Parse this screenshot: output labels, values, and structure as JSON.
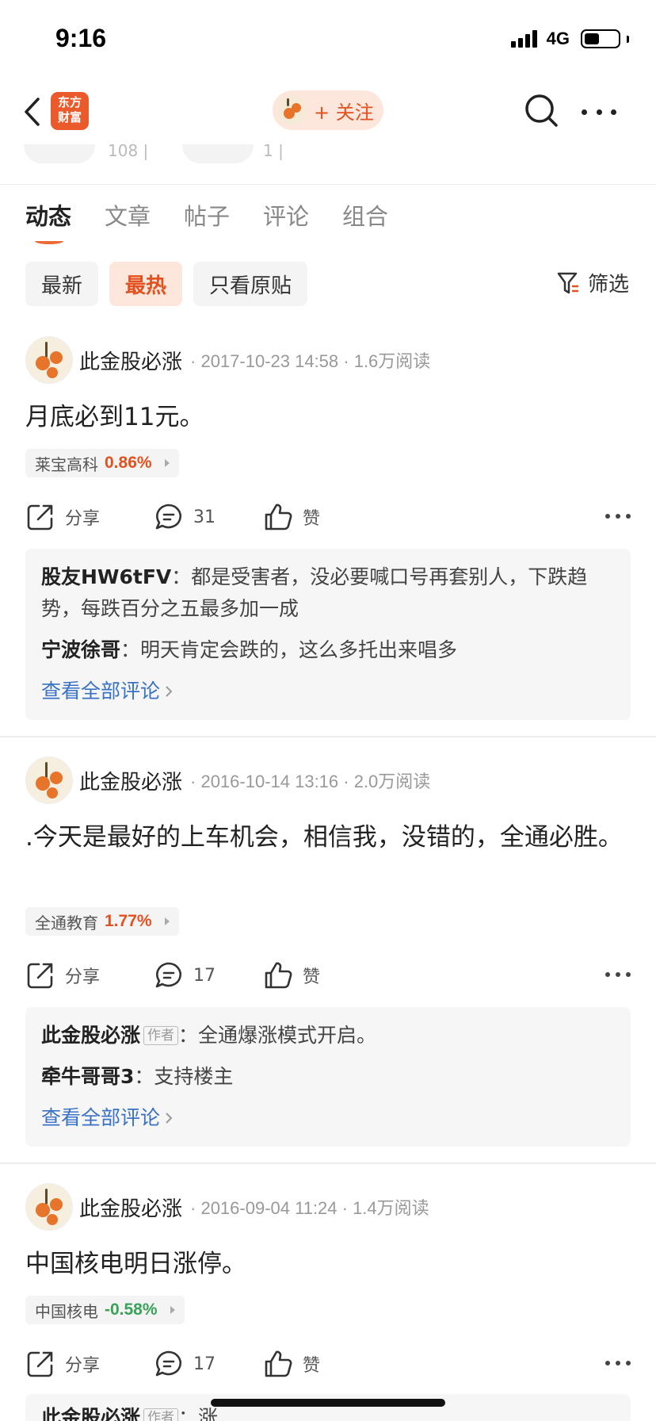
{
  "status_bar": {
    "time": "9:16",
    "network": "4G",
    "battery_level": 0.45
  },
  "nav": {
    "logo_line1": "东方",
    "logo_line2": "财富",
    "follow_label": "+ 关注",
    "colors": {
      "accent": "#e2511f",
      "follow_bg": "#fde7dc",
      "logo_bg": "#ea5a2a"
    }
  },
  "peek": {
    "left_text": "108 |",
    "right_text": "1 |"
  },
  "tabs": [
    {
      "label": "动态",
      "active": true
    },
    {
      "label": "文章",
      "active": false
    },
    {
      "label": "帖子",
      "active": false
    },
    {
      "label": "评论",
      "active": false
    },
    {
      "label": "组合",
      "active": false
    }
  ],
  "filters": [
    {
      "label": "最新",
      "active": false
    },
    {
      "label": "最热",
      "active": true
    },
    {
      "label": "只看原贴",
      "active": false
    }
  ],
  "filter_button": "筛选",
  "posts": [
    {
      "author": "此金股必涨",
      "meta": "· 2017-10-23 14:58 · 1.6万阅读",
      "content": "月底必到11元。",
      "stock": {
        "name": "莱宝高科",
        "pct": "0.86%",
        "direction": "up"
      },
      "share_label": "分享",
      "comment_count": "31",
      "like_label": "赞",
      "comments": [
        {
          "name": "股友HW6tFV",
          "author_tag": "",
          "sep": "：",
          "text": "都是受害者，没必要喊口号再套别人，下跌趋势，每跌百分之五最多加一成"
        },
        {
          "name": "宁波徐哥",
          "author_tag": "",
          "sep": "：",
          "text": "明天肯定会跌的，这么多托出来唱多"
        }
      ],
      "view_all": "查看全部评论"
    },
    {
      "author": "此金股必涨",
      "meta": "· 2016-10-14 13:16 · 2.0万阅读",
      "content": ".今天是最好的上车机会，相信我，没错的，全通必胜。",
      "stock": {
        "name": "全通教育",
        "pct": "1.77%",
        "direction": "up"
      },
      "share_label": "分享",
      "comment_count": "17",
      "like_label": "赞",
      "comments": [
        {
          "name": "此金股必涨",
          "author_tag": "作者",
          "sep": "：",
          "text": "全通爆涨模式开启。"
        },
        {
          "name": "牵牛哥哥3",
          "author_tag": "",
          "sep": "：",
          "text": "支持楼主"
        }
      ],
      "view_all": "查看全部评论"
    },
    {
      "author": "此金股必涨",
      "meta": "· 2016-09-04 11:24 · 1.4万阅读",
      "content": "中国核电明日涨停。",
      "stock": {
        "name": "中国核电",
        "pct": "-0.58%",
        "direction": "down"
      },
      "share_label": "分享",
      "comment_count": "17",
      "like_label": "赞",
      "comments": [
        {
          "name": "此金股必涨",
          "author_tag": "作者",
          "sep": "：",
          "text": "涨"
        }
      ],
      "view_all": ""
    }
  ]
}
